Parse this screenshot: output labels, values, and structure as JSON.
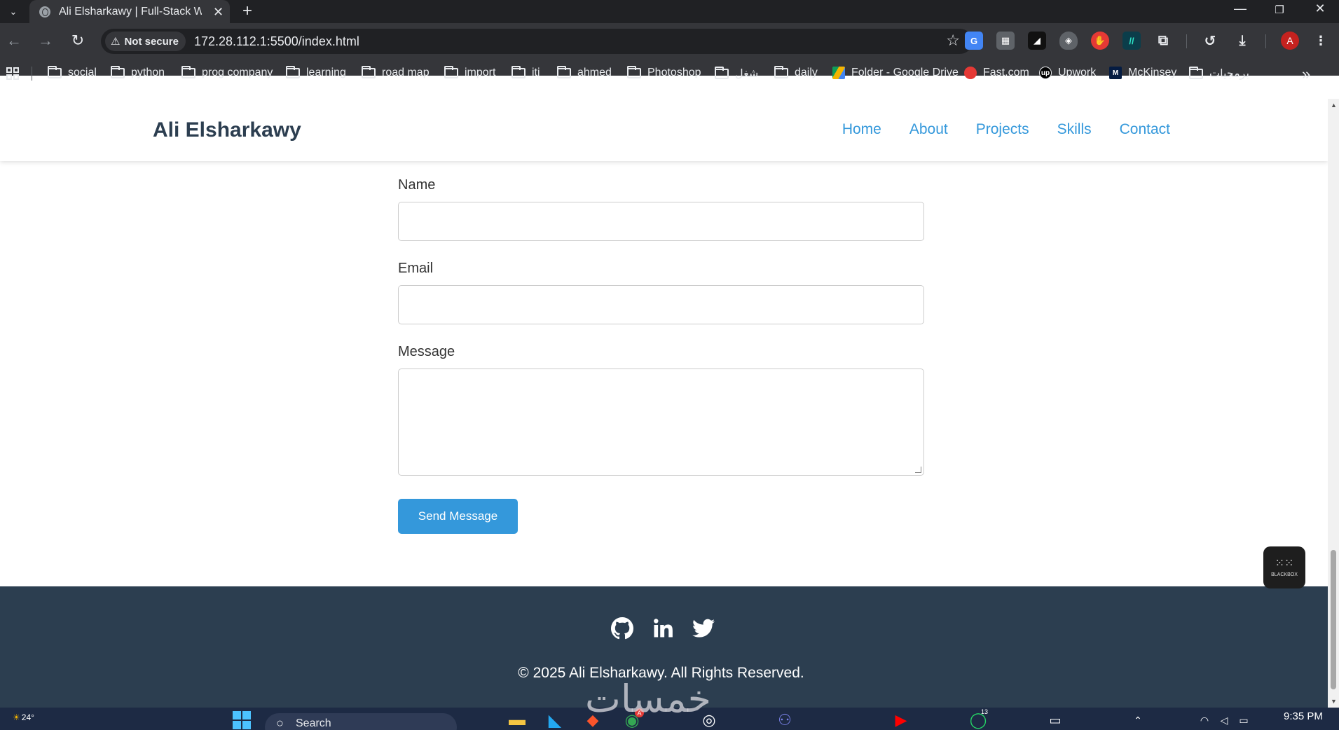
{
  "browser": {
    "tab_title": "Ali Elsharkawy | Full-Stack Web",
    "security_label": "Not secure",
    "url": "172.28.112.1:5500/index.html",
    "bookmarks": [
      {
        "label": "social",
        "kind": "folder"
      },
      {
        "label": "python",
        "kind": "folder"
      },
      {
        "label": "prog company",
        "kind": "folder"
      },
      {
        "label": "learning",
        "kind": "folder"
      },
      {
        "label": "road map",
        "kind": "folder"
      },
      {
        "label": "import",
        "kind": "folder"
      },
      {
        "label": "iti",
        "kind": "folder"
      },
      {
        "label": "ahmed",
        "kind": "folder"
      },
      {
        "label": "Photoshop",
        "kind": "folder"
      },
      {
        "label": "شغل",
        "kind": "folder"
      },
      {
        "label": "daily",
        "kind": "folder"
      },
      {
        "label": "Folder - Google Drive",
        "kind": "drive"
      },
      {
        "label": "Fast.com",
        "kind": "site"
      },
      {
        "label": "Upwork",
        "kind": "site"
      },
      {
        "label": "McKinsey",
        "kind": "site"
      },
      {
        "label": "برمجيات",
        "kind": "folder"
      }
    ],
    "profile_initial": "A"
  },
  "site": {
    "brand": "Ali Elsharkawy",
    "nav": [
      "Home",
      "About",
      "Projects",
      "Skills",
      "Contact"
    ],
    "accent_color": "#3498db",
    "dark_color": "#2c3e50"
  },
  "contact_form": {
    "name_label": "Name",
    "email_label": "Email",
    "message_label": "Message",
    "name_value": "",
    "email_value": "",
    "message_value": "",
    "submit_label": "Send Message"
  },
  "footer": {
    "social_icons": [
      "github-icon",
      "linkedin-icon",
      "twitter-icon"
    ],
    "copyright": "© 2025 Ali Elsharkawy. All Rights Reserved."
  },
  "overlay": {
    "blackbox_label": "BLACKBOX",
    "watermark": "خمسات"
  },
  "taskbar": {
    "weather": "24°",
    "search_placeholder": "Search",
    "time": "9:35 PM",
    "notification_count": "13",
    "chrome_badge": "A"
  }
}
